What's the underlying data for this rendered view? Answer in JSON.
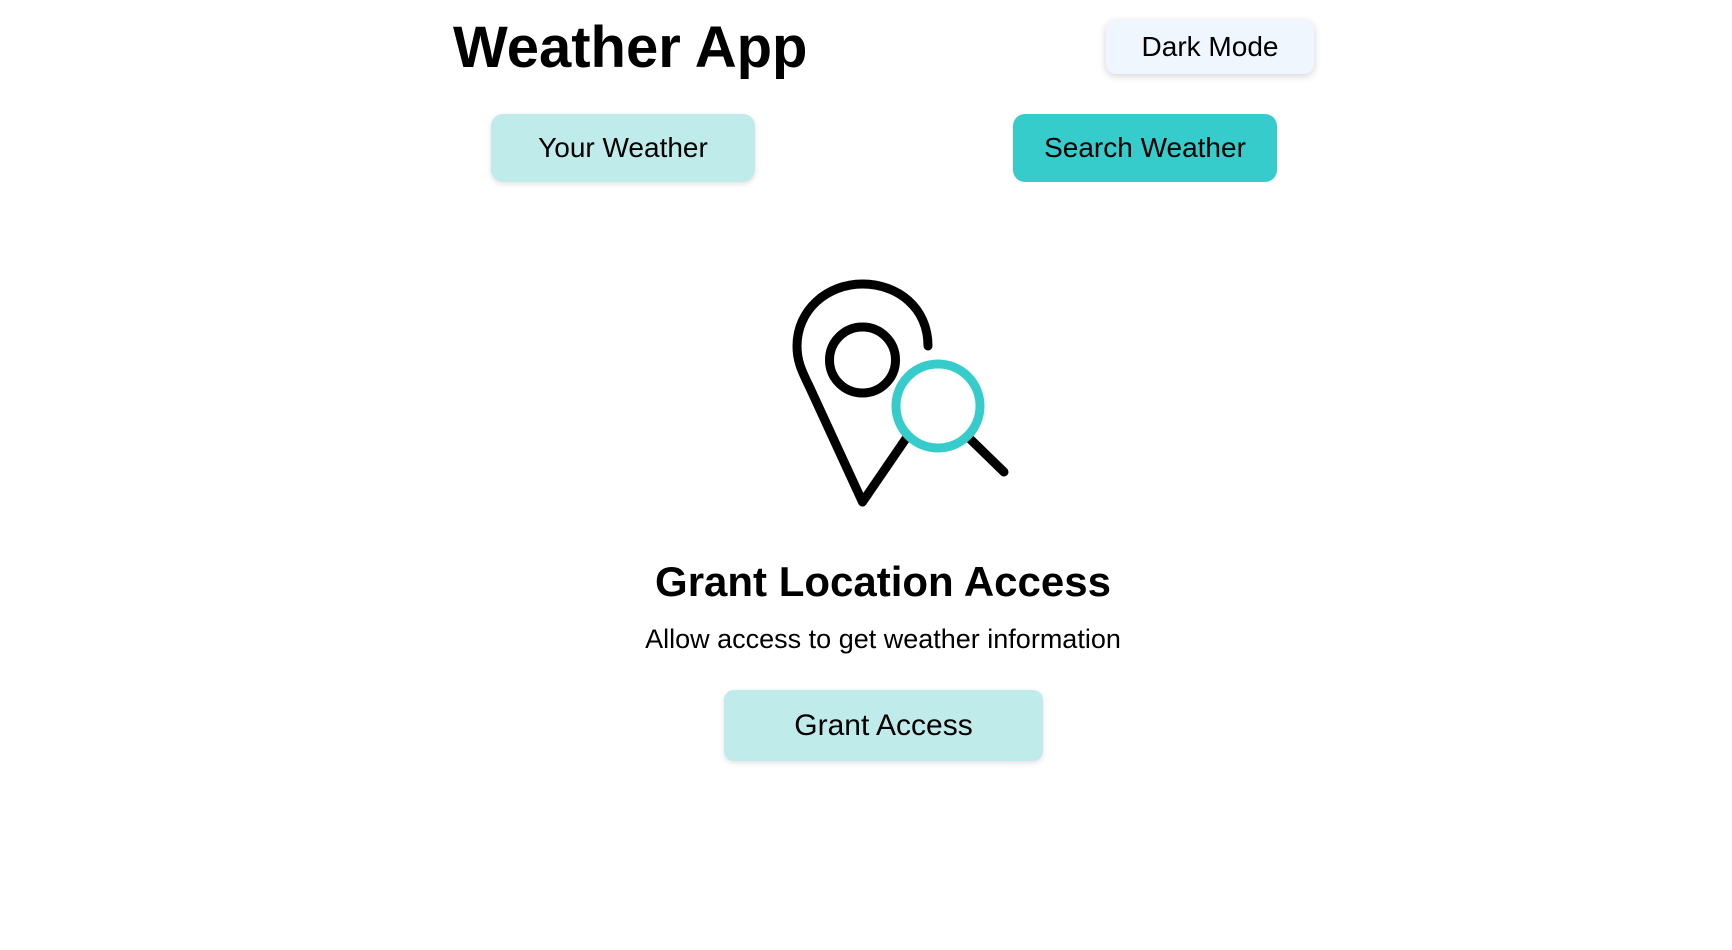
{
  "header": {
    "title": "Weather App",
    "dark_mode_label": "Dark Mode"
  },
  "tabs": [
    {
      "label": "Your Weather",
      "active": false
    },
    {
      "label": "Search Weather",
      "active": true
    }
  ],
  "grant_location": {
    "icon": "location-search-icon",
    "title": "Grant Location Access",
    "subtitle": "Allow access to get weather information",
    "button_label": "Grant Access"
  },
  "colors": {
    "accent": "#36cccb",
    "accent_light": "#c0ebeb",
    "dark_mode_button_bg": "#f0f6fd",
    "text": "#000000",
    "background": "#ffffff"
  }
}
